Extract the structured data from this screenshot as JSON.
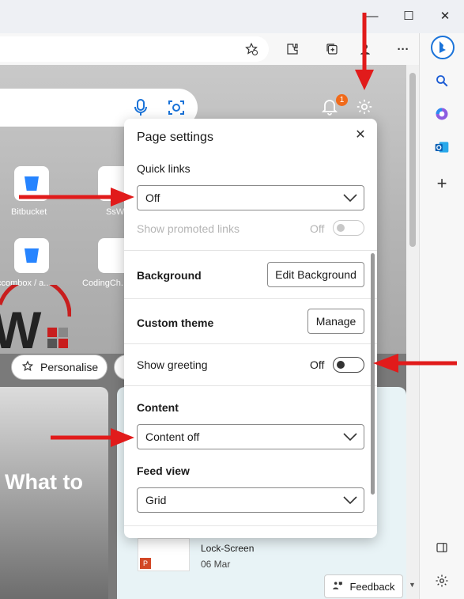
{
  "browser": {
    "window_controls": {
      "minimize": "—",
      "maximize": "☐",
      "close": "✕"
    },
    "toolbar_icons": [
      "favorite-add-icon",
      "extensions-icon",
      "collections-icon",
      "profile-icon",
      "more-icon",
      "copilot-icon"
    ],
    "more_label": "···",
    "sidebar_icons": [
      "search-icon",
      "copilot-icon",
      "outlook-icon",
      "add-icon",
      "sidebar-toggle-icon",
      "settings-icon"
    ],
    "add_label": "+"
  },
  "newtab": {
    "notification_count": "1",
    "quick_links": [
      {
        "label": "Bitbucket"
      },
      {
        "label": "SsW"
      },
      {
        "label": "ccombox / a..."
      },
      {
        "label": "CodingCh..."
      }
    ],
    "personalise_label": "Personalise",
    "feed_headline": "What to",
    "feed_card": {
      "title": "Lock-Screen",
      "date": "06 Mar"
    },
    "feedback_label": "Feedback"
  },
  "settings_panel": {
    "title": "Page settings",
    "close_label": "✕",
    "quick_links": {
      "label": "Quick links",
      "value": "Off"
    },
    "promoted_links": {
      "label": "Show promoted links",
      "state_label": "Off"
    },
    "background": {
      "label": "Background",
      "button": "Edit Background"
    },
    "custom_theme": {
      "label": "Custom theme",
      "button": "Manage"
    },
    "greeting": {
      "label": "Show greeting",
      "state_label": "Off"
    },
    "content": {
      "label": "Content",
      "value": "Content off"
    },
    "feed_view": {
      "label": "Feed view",
      "value": "Grid"
    }
  },
  "colors": {
    "annotation_arrow": "#e11b1b",
    "badge": "#f06a1a",
    "accent_blue": "#2684ff"
  }
}
